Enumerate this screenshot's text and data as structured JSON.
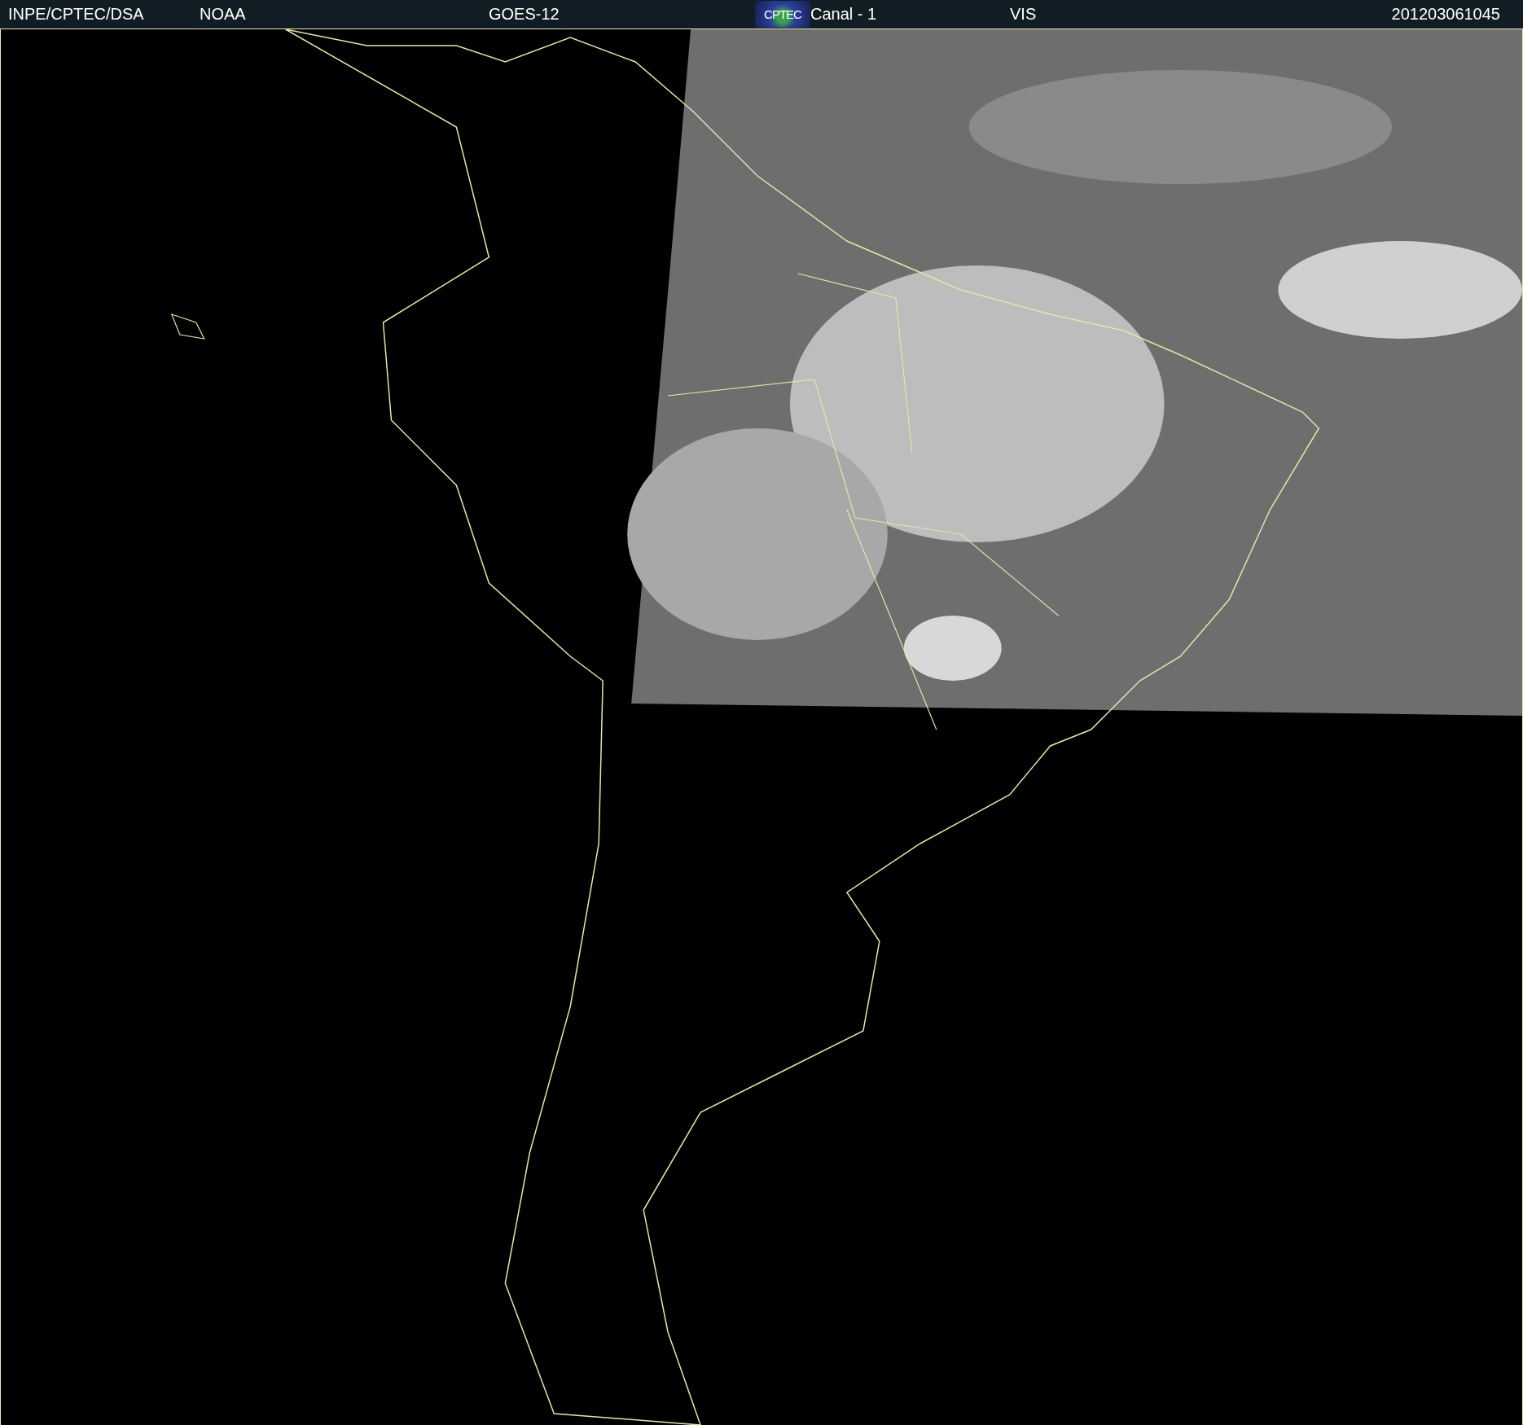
{
  "header": {
    "source": "INPE/CPTEC/DSA",
    "agency": "NOAA",
    "satellite": "GOES-12",
    "logo": "CPTEC",
    "channel": "Canal - 1",
    "band": "VIS",
    "timestamp": "201203061045"
  }
}
